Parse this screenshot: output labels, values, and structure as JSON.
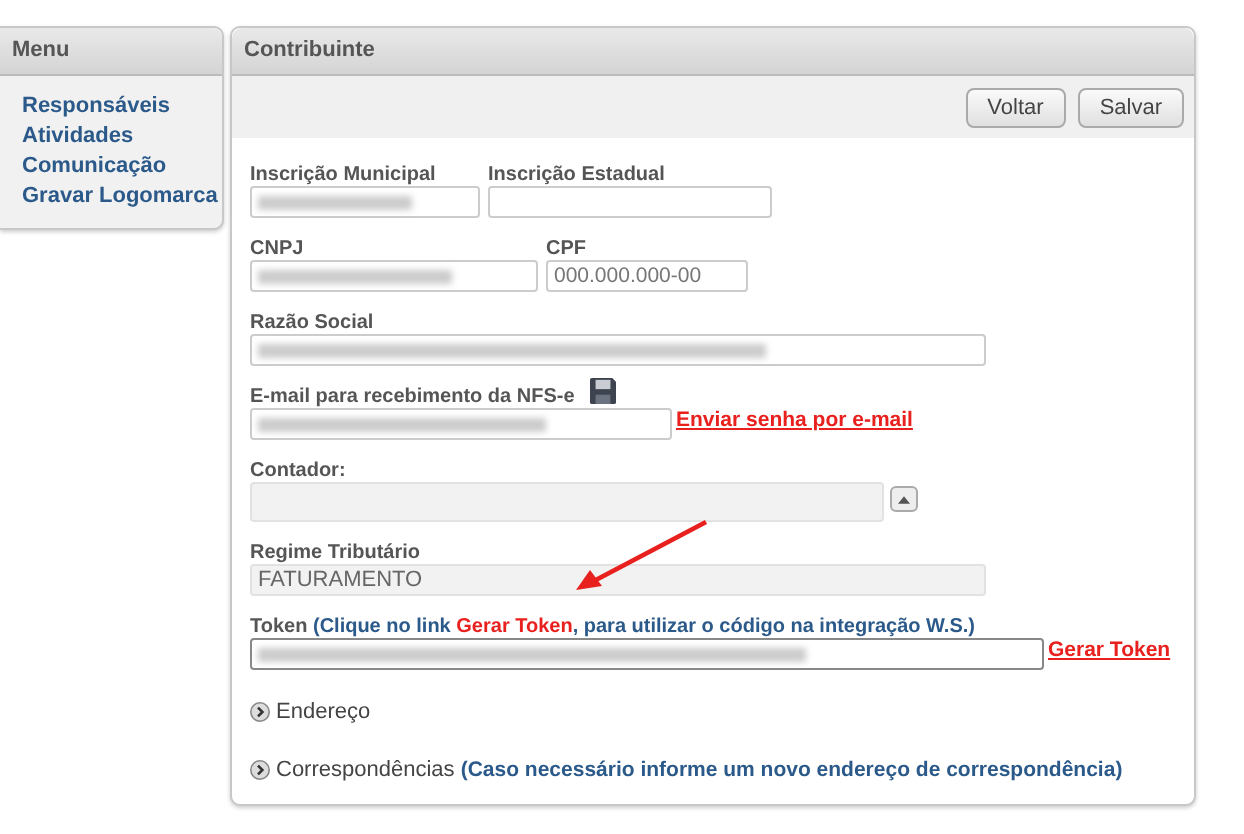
{
  "menu": {
    "title": "Menu",
    "items": [
      "Responsáveis",
      "Atividades",
      "Comunicação",
      "Gravar Logomarca"
    ]
  },
  "panel": {
    "title": "Contribuinte",
    "buttons": [
      "Voltar",
      "Salvar"
    ]
  },
  "rows": [
    [
      {
        "kind": "text",
        "label": "Inscrição Municipal",
        "redacted": true
      },
      {
        "kind": "text",
        "label": "Inscrição Estadual",
        "redacted": false
      }
    ],
    [
      {
        "kind": "text",
        "label": "CNPJ",
        "redacted": true
      },
      {
        "kind": "text",
        "label": "CPF",
        "placeholder": "000.000.000-00",
        "redacted": false
      }
    ],
    [
      {
        "kind": "text",
        "label": "Razão Social",
        "redacted": true
      }
    ],
    [
      {
        "kind": "email",
        "label": "E-mail para recebimento da NFS-e",
        "redacted": true,
        "link": "Enviar senha por e-mail"
      }
    ],
    [
      {
        "kind": "select",
        "label": "Contador:",
        "redacted": false
      }
    ],
    [
      {
        "kind": "readonly",
        "label": "Regime Tributário",
        "value": "FATURAMENTO",
        "redacted": false
      }
    ],
    [
      {
        "kind": "token",
        "label_parts": [
          {
            "text": "Token ",
            "color": "#555555"
          },
          {
            "text": "(Clique no link ",
            "color": "#2b5a8a"
          },
          {
            "text": "Gerar Token",
            "color": "#e8201e"
          },
          {
            "text": ", para utilizar o código na integração W.S.)",
            "color": "#2b5a8a"
          }
        ],
        "redacted": true,
        "link": "Gerar Token"
      }
    ]
  ],
  "sections": [
    {
      "title": "Endereço",
      "expanded": false
    },
    {
      "title": "Correspondências",
      "note": "(Caso necessário informe um novo endereço de correspondência)",
      "expanded": false
    }
  ]
}
